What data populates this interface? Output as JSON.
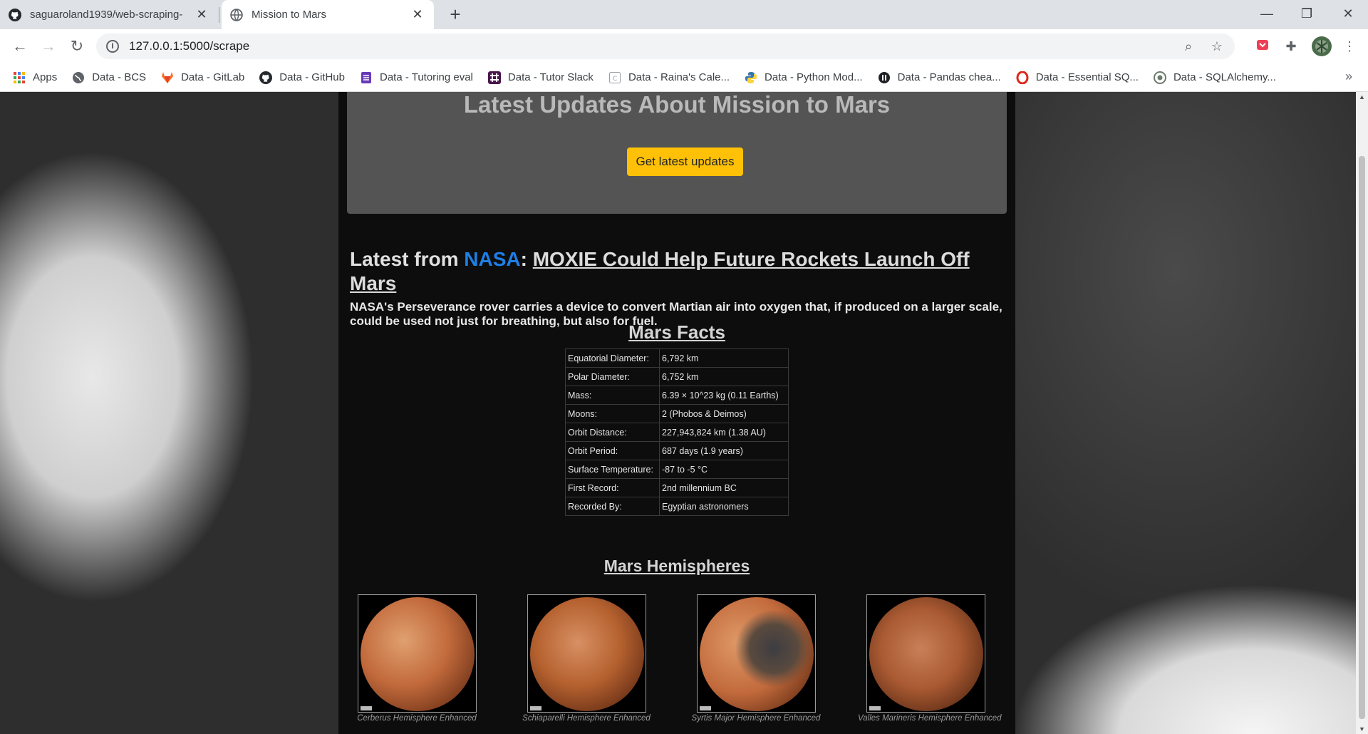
{
  "browser": {
    "tabs": [
      {
        "title": "saguaroland1939/web-scraping-",
        "active": false
      },
      {
        "title": "Mission to Mars",
        "active": true
      }
    ],
    "url": "127.0.0.1:5000/scrape",
    "bookmarks": [
      {
        "label": "Apps",
        "icon": "apps-grid-icon",
        "color": "#ea4335"
      },
      {
        "label": "Data - BCS",
        "icon": "globe-icon",
        "color": "#5f6368"
      },
      {
        "label": "Data - GitLab",
        "icon": "gitlab-icon",
        "color": "#fc6d26"
      },
      {
        "label": "Data - GitHub",
        "icon": "github-icon",
        "color": "#24292e"
      },
      {
        "label": "Data - Tutoring eval",
        "icon": "form-icon",
        "color": "#673ab7"
      },
      {
        "label": "Data - Tutor Slack",
        "icon": "slack-icon",
        "color": "#4a154b"
      },
      {
        "label": "Data - Raina's Cale...",
        "icon": "calendar-icon",
        "color": "#9aa0a6"
      },
      {
        "label": "Data - Python Mod...",
        "icon": "python-icon",
        "color": "#3776ab"
      },
      {
        "label": "Data - Pandas chea...",
        "icon": "pandas-icon",
        "color": "#202124"
      },
      {
        "label": "Data - Essential SQ...",
        "icon": "opera-icon",
        "color": "#e1251b"
      },
      {
        "label": "Data - SQLAlchemy...",
        "icon": "sqlalchemy-icon",
        "color": "#6b7b6b"
      }
    ]
  },
  "page": {
    "jumbotron": {
      "title": "Latest Updates About Mission to Mars",
      "button_label": "Get latest updates"
    },
    "news": {
      "prefix": "Latest from ",
      "source": "NASA",
      "separator": ": ",
      "headline": "MOXIE Could Help Future Rockets Launch Off Mars",
      "teaser": "NASA's Perseverance rover carries a device to convert Martian air into oxygen that, if produced on a larger scale, could be used not just for breathing, but also for fuel."
    },
    "facts": {
      "title": "Mars Facts",
      "rows": [
        {
          "key": "Equatorial Diameter:",
          "value": "6,792 km"
        },
        {
          "key": "Polar Diameter:",
          "value": "6,752 km"
        },
        {
          "key": "Mass:",
          "value": "6.39 × 10^23 kg (0.11 Earths)"
        },
        {
          "key": "Moons:",
          "value": "2 (Phobos & Deimos)"
        },
        {
          "key": "Orbit Distance:",
          "value": "227,943,824 km (1.38 AU)"
        },
        {
          "key": "Orbit Period:",
          "value": "687 days (1.9 years)"
        },
        {
          "key": "Surface Temperature:",
          "value": "-87 to -5 °C"
        },
        {
          "key": "First Record:",
          "value": "2nd millennium BC"
        },
        {
          "key": "Recorded By:",
          "value": "Egyptian astronomers"
        }
      ]
    },
    "hemispheres": {
      "title": "Mars Hemispheres",
      "items": [
        {
          "caption": "Cerberus Hemisphere Enhanced"
        },
        {
          "caption": "Schiaparelli Hemisphere Enhanced"
        },
        {
          "caption": "Syrtis Major Hemisphere Enhanced"
        },
        {
          "caption": "Valles Marineris Hemisphere Enhanced"
        }
      ]
    }
  }
}
